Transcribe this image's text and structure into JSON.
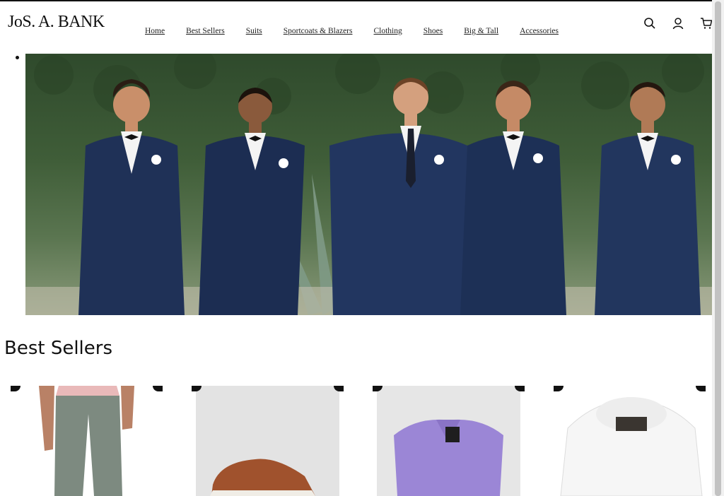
{
  "brand": {
    "logo_text": "JoS. A. BANK"
  },
  "nav": {
    "items": [
      "Home",
      "Best Sellers",
      "Suits",
      "Sportcoats & Blazers",
      "Clothing",
      "Shoes",
      "Big & Tall",
      "Accessories"
    ]
  },
  "header_icons": [
    "search-icon",
    "account-icon",
    "cart-icon"
  ],
  "hero": {
    "image": "groomsmen-in-navy-suits"
  },
  "best_sellers": {
    "title": "Best Sellers",
    "products": [
      {
        "image": "grey-dress-pants"
      },
      {
        "image": "brown-leather-shoe"
      },
      {
        "image": "purple-polo-shirt"
      },
      {
        "image": "white-dress-shirt"
      }
    ]
  },
  "colors": {
    "accent": "#111111",
    "background": "#ffffff"
  }
}
